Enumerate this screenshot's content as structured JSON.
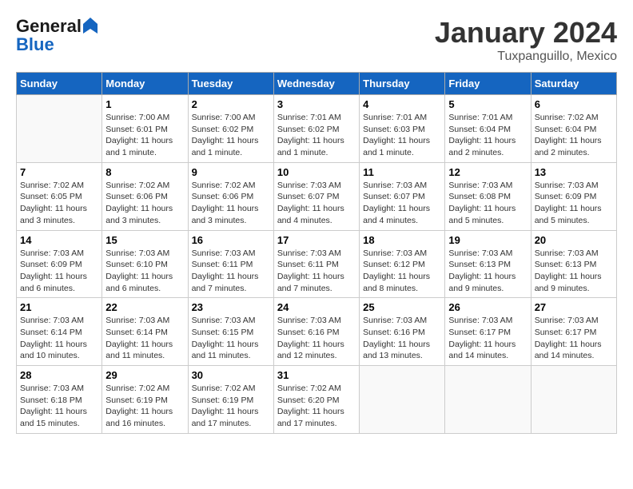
{
  "logo": {
    "line1": "General",
    "line2": "Blue"
  },
  "title": "January 2024",
  "subtitle": "Tuxpanguillo, Mexico",
  "days_header": [
    "Sunday",
    "Monday",
    "Tuesday",
    "Wednesday",
    "Thursday",
    "Friday",
    "Saturday"
  ],
  "weeks": [
    [
      {
        "day": "",
        "info": ""
      },
      {
        "day": "1",
        "info": "Sunrise: 7:00 AM\nSunset: 6:01 PM\nDaylight: 11 hours\nand 1 minute."
      },
      {
        "day": "2",
        "info": "Sunrise: 7:00 AM\nSunset: 6:02 PM\nDaylight: 11 hours\nand 1 minute."
      },
      {
        "day": "3",
        "info": "Sunrise: 7:01 AM\nSunset: 6:02 PM\nDaylight: 11 hours\nand 1 minute."
      },
      {
        "day": "4",
        "info": "Sunrise: 7:01 AM\nSunset: 6:03 PM\nDaylight: 11 hours\nand 1 minute."
      },
      {
        "day": "5",
        "info": "Sunrise: 7:01 AM\nSunset: 6:04 PM\nDaylight: 11 hours\nand 2 minutes."
      },
      {
        "day": "6",
        "info": "Sunrise: 7:02 AM\nSunset: 6:04 PM\nDaylight: 11 hours\nand 2 minutes."
      }
    ],
    [
      {
        "day": "7",
        "info": "Sunrise: 7:02 AM\nSunset: 6:05 PM\nDaylight: 11 hours\nand 3 minutes."
      },
      {
        "day": "8",
        "info": "Sunrise: 7:02 AM\nSunset: 6:06 PM\nDaylight: 11 hours\nand 3 minutes."
      },
      {
        "day": "9",
        "info": "Sunrise: 7:02 AM\nSunset: 6:06 PM\nDaylight: 11 hours\nand 3 minutes."
      },
      {
        "day": "10",
        "info": "Sunrise: 7:03 AM\nSunset: 6:07 PM\nDaylight: 11 hours\nand 4 minutes."
      },
      {
        "day": "11",
        "info": "Sunrise: 7:03 AM\nSunset: 6:07 PM\nDaylight: 11 hours\nand 4 minutes."
      },
      {
        "day": "12",
        "info": "Sunrise: 7:03 AM\nSunset: 6:08 PM\nDaylight: 11 hours\nand 5 minutes."
      },
      {
        "day": "13",
        "info": "Sunrise: 7:03 AM\nSunset: 6:09 PM\nDaylight: 11 hours\nand 5 minutes."
      }
    ],
    [
      {
        "day": "14",
        "info": "Sunrise: 7:03 AM\nSunset: 6:09 PM\nDaylight: 11 hours\nand 6 minutes."
      },
      {
        "day": "15",
        "info": "Sunrise: 7:03 AM\nSunset: 6:10 PM\nDaylight: 11 hours\nand 6 minutes."
      },
      {
        "day": "16",
        "info": "Sunrise: 7:03 AM\nSunset: 6:11 PM\nDaylight: 11 hours\nand 7 minutes."
      },
      {
        "day": "17",
        "info": "Sunrise: 7:03 AM\nSunset: 6:11 PM\nDaylight: 11 hours\nand 7 minutes."
      },
      {
        "day": "18",
        "info": "Sunrise: 7:03 AM\nSunset: 6:12 PM\nDaylight: 11 hours\nand 8 minutes."
      },
      {
        "day": "19",
        "info": "Sunrise: 7:03 AM\nSunset: 6:13 PM\nDaylight: 11 hours\nand 9 minutes."
      },
      {
        "day": "20",
        "info": "Sunrise: 7:03 AM\nSunset: 6:13 PM\nDaylight: 11 hours\nand 9 minutes."
      }
    ],
    [
      {
        "day": "21",
        "info": "Sunrise: 7:03 AM\nSunset: 6:14 PM\nDaylight: 11 hours\nand 10 minutes."
      },
      {
        "day": "22",
        "info": "Sunrise: 7:03 AM\nSunset: 6:14 PM\nDaylight: 11 hours\nand 11 minutes."
      },
      {
        "day": "23",
        "info": "Sunrise: 7:03 AM\nSunset: 6:15 PM\nDaylight: 11 hours\nand 11 minutes."
      },
      {
        "day": "24",
        "info": "Sunrise: 7:03 AM\nSunset: 6:16 PM\nDaylight: 11 hours\nand 12 minutes."
      },
      {
        "day": "25",
        "info": "Sunrise: 7:03 AM\nSunset: 6:16 PM\nDaylight: 11 hours\nand 13 minutes."
      },
      {
        "day": "26",
        "info": "Sunrise: 7:03 AM\nSunset: 6:17 PM\nDaylight: 11 hours\nand 14 minutes."
      },
      {
        "day": "27",
        "info": "Sunrise: 7:03 AM\nSunset: 6:17 PM\nDaylight: 11 hours\nand 14 minutes."
      }
    ],
    [
      {
        "day": "28",
        "info": "Sunrise: 7:03 AM\nSunset: 6:18 PM\nDaylight: 11 hours\nand 15 minutes."
      },
      {
        "day": "29",
        "info": "Sunrise: 7:02 AM\nSunset: 6:19 PM\nDaylight: 11 hours\nand 16 minutes."
      },
      {
        "day": "30",
        "info": "Sunrise: 7:02 AM\nSunset: 6:19 PM\nDaylight: 11 hours\nand 17 minutes."
      },
      {
        "day": "31",
        "info": "Sunrise: 7:02 AM\nSunset: 6:20 PM\nDaylight: 11 hours\nand 17 minutes."
      },
      {
        "day": "",
        "info": ""
      },
      {
        "day": "",
        "info": ""
      },
      {
        "day": "",
        "info": ""
      }
    ]
  ]
}
